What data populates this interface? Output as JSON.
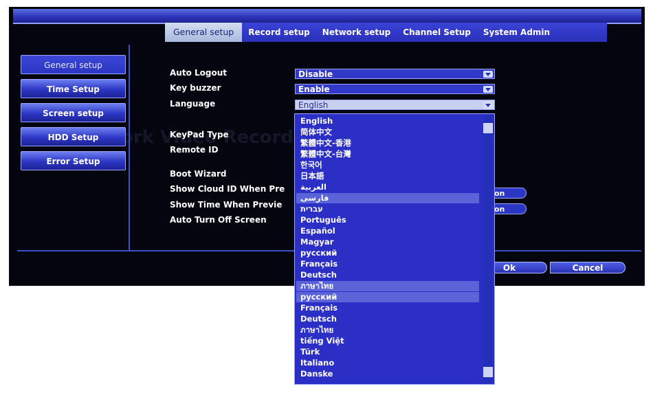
{
  "tabs": [
    {
      "label": "General setup",
      "active": true
    },
    {
      "label": "Record setup",
      "active": false
    },
    {
      "label": "Network setup",
      "active": false
    },
    {
      "label": "Channel Setup",
      "active": false
    },
    {
      "label": "System Admin",
      "active": false
    }
  ],
  "sidebar": {
    "items": [
      {
        "label": "General setup",
        "active": true
      },
      {
        "label": "Time Setup",
        "active": false
      },
      {
        "label": "Screen setup",
        "active": false
      },
      {
        "label": "HDD Setup",
        "active": false
      },
      {
        "label": "Error Setup",
        "active": false
      }
    ]
  },
  "form": {
    "auto_logout": {
      "label": "Auto Logout",
      "value": "Disable"
    },
    "key_buzzer": {
      "label": "Key buzzer",
      "value": "Enable"
    },
    "language": {
      "label": "Language",
      "value": "English"
    },
    "keypad_type": {
      "label": "KeyPad Type"
    },
    "remote_id": {
      "label": "Remote ID"
    },
    "boot_wizard": {
      "label": "Boot Wizard"
    },
    "show_cloud_id": {
      "label": "Show Cloud ID When Pre",
      "value": "on"
    },
    "show_time": {
      "label": "Show Time When Previe",
      "value": "on"
    },
    "auto_turn_off": {
      "label": "Auto Turn Off Screen"
    }
  },
  "buttons": {
    "ok": "Ok",
    "cancel": "Cancel"
  },
  "language_dropdown": {
    "options": [
      "English",
      "简体中文",
      "繁體中文-香港",
      "繁體中文-台灣",
      "한국어",
      "日本語",
      "العربية",
      "فارسی",
      "עברית",
      "Português",
      "Español",
      "Magyar",
      "русский",
      "Français",
      "Deutsch",
      "ภาษาไทย",
      "русский",
      "Français",
      "Deutsch",
      "ภาษาไทย",
      "tiếng Việt",
      "Türk",
      "Italiano",
      "Danske"
    ],
    "highlighted": [
      7,
      15,
      16
    ]
  },
  "colors": {
    "accent": "#2b2fc6",
    "background": "#050510",
    "highlight": "#5a64d8"
  }
}
